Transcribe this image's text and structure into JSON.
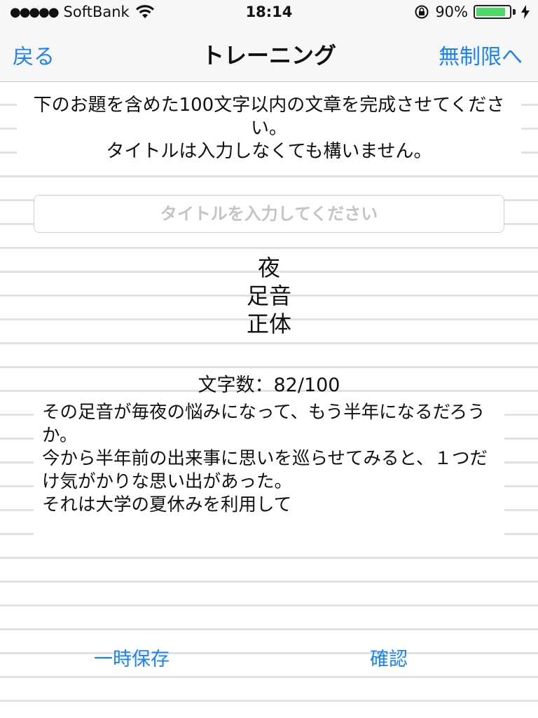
{
  "status_bar": {
    "signal": "●●●●●",
    "carrier": "SoftBank",
    "time": "18:14",
    "battery_percent": "90%",
    "battery_level": 0.9
  },
  "nav": {
    "back_label": "戻る",
    "title": "トレーニング",
    "right_label": "無制限へ"
  },
  "instructions": {
    "line1": "下のお題を含めた100文字以内の文章を完成させてください。",
    "line2": "タイトルは入力しなくても構いません。"
  },
  "title_input": {
    "value": "",
    "placeholder": "タイトルを入力してください"
  },
  "topics": [
    "夜",
    "足音",
    "正体"
  ],
  "char_count": "文字数：82/100",
  "body_text": "その足音が毎夜の悩みになって、もう半年になるだろうか。\n今から半年前の出来事に思いを巡らせてみると、１つだけ気がかりな思い出があった。\nそれは大学の夏休みを利用して",
  "buttons": {
    "save_label": "一時保存",
    "confirm_label": "確認"
  },
  "colors": {
    "accent": "#1a82fb",
    "battery": "#4cd964"
  }
}
